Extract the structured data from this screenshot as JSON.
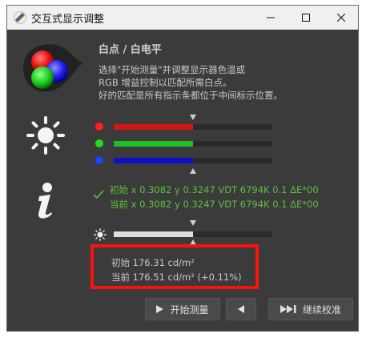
{
  "window": {
    "title": "交互式显示调整",
    "controls": {
      "minimize_icon": "minimize-icon",
      "maximize_icon": "maximize-icon",
      "close_icon": "close-icon"
    }
  },
  "section": {
    "heading": "白点 / 白电平",
    "description": [
      "选择\"开始测量\"并调整显示器色温或",
      "RGB 增益控制以匹配所需白点。",
      "好的匹配是所有指示条都位于中间标示位置。"
    ]
  },
  "rgb_bars": [
    {
      "channel": "red",
      "color": "#ff2020",
      "fill_color": "#d01818",
      "level": 0.5
    },
    {
      "channel": "green",
      "color": "#22dd22",
      "fill_color": "#20c020",
      "level": 0.5
    },
    {
      "channel": "blue",
      "color": "#2040ff",
      "fill_color": "#1010c8",
      "level": 0.5
    }
  ],
  "measurements": {
    "status_icon": "check-icon",
    "initial": "初始 x 0.3082 y 0.3247 VDT 6794K 0.1 ΔE*00",
    "current": "当前 x 0.3082 y 0.3247 VDT 6794K 0.1 ΔE*00"
  },
  "luminance": {
    "level": 0.5,
    "fill_color": "#e0e0e0",
    "initial": "初始 176.31 cd/m²",
    "current": "当前 176.51 cd/m² (+0.11%)"
  },
  "buttons": {
    "start": {
      "label": "开始测量",
      "icon": "play-icon"
    },
    "prev": {
      "icon": "back-icon"
    },
    "next": {
      "label": "继续校准",
      "icon": "skip-forward-icon"
    }
  },
  "colors": {
    "accent_green": "#5cc23c",
    "highlight_red": "#ff1010",
    "window_bg": "#3b3b3b"
  }
}
